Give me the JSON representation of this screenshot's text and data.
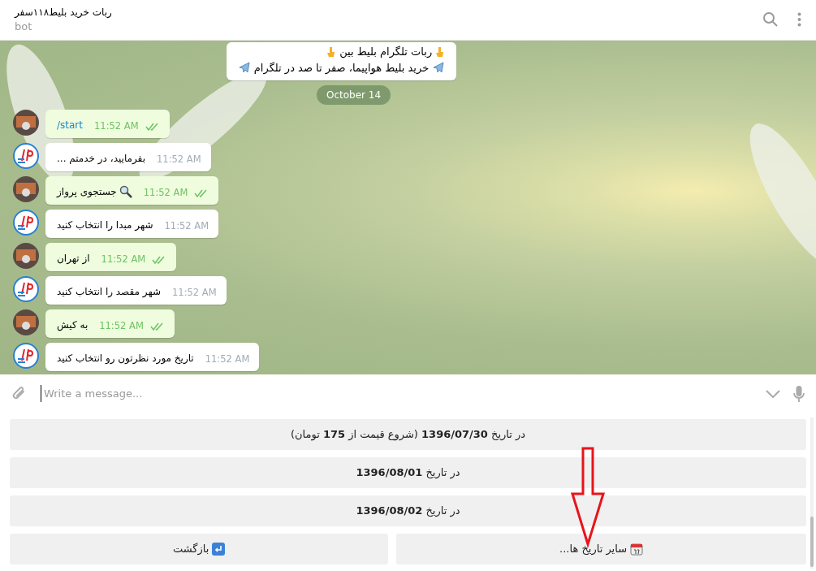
{
  "header": {
    "title": "ربات خرید بلیط۱۱۸سفر",
    "subtitle": "bot"
  },
  "intro_message": {
    "lines": [
      "ربات تلگرام بلیط بین",
      "خرید بلیط هواپیما، صفر تا صد در تلگرام"
    ]
  },
  "date_separator": "October 14",
  "messages": [
    {
      "kind": "outgoing",
      "text": "/start",
      "time": "11:52 AM",
      "read": true,
      "command": true
    },
    {
      "kind": "incoming",
      "text": "بفرمایید، در خدمتم ...",
      "time": "11:52 AM"
    },
    {
      "kind": "outgoing",
      "text": "جستجوی پرواز",
      "time": "11:52 AM",
      "read": true,
      "search_icon": true
    },
    {
      "kind": "incoming",
      "text": "شهر مبدا را انتخاب کنید",
      "time": "11:52 AM"
    },
    {
      "kind": "outgoing",
      "text": "از تهران",
      "time": "11:52 AM",
      "read": true
    },
    {
      "kind": "incoming",
      "text": "شهر مقصد را انتخاب کنید",
      "time": "11:52 AM"
    },
    {
      "kind": "outgoing",
      "text": "به کیش",
      "time": "11:52 AM",
      "read": true
    },
    {
      "kind": "incoming",
      "text": "تاریخ مورد نظرتون رو انتخاب کنید",
      "time": "11:52 AM"
    }
  ],
  "composer": {
    "placeholder": "Write a message..."
  },
  "keyboard": [
    [
      {
        "text": "در تاریخ **1396/07/30** (شروع قیمت از **175** تومان)"
      }
    ],
    [
      {
        "text": "در تاریخ **1396/08/01**"
      }
    ],
    [
      {
        "text": "در تاریخ **1396/08/02**"
      }
    ],
    [
      {
        "text": "سایر تاریخ ها...",
        "kind": "more_dates"
      },
      {
        "text": "بازگشت",
        "kind": "back"
      }
    ]
  ]
}
